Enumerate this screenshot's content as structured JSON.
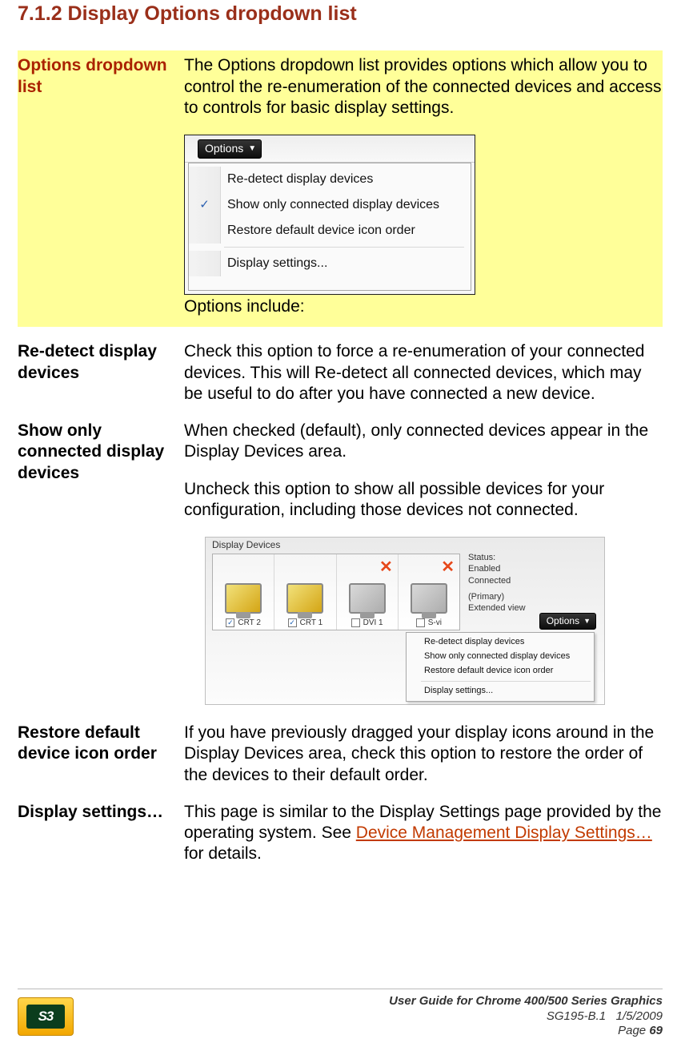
{
  "heading": "7.1.2 Display Options dropdown list",
  "rows": {
    "options_dropdown": {
      "term": "Options dropdown list",
      "intro": "The Options dropdown list provides options which allow you to control the re-enumeration of the connected devices and access to controls for basic display settings.",
      "include_label": "Options include:"
    },
    "redetect": {
      "term": "Re-detect display devices",
      "desc": "Check this option to force a re-enumeration of your connected devices. This will Re-detect all connected devices, which may be useful to do after you have connected a new device."
    },
    "showonly": {
      "term": "Show only connected display devices",
      "p1": "When checked (default), only connected devices appear in the Display Devices area.",
      "p2": "Uncheck this option to show all possible devices for your configuration, including those devices not connected."
    },
    "restore": {
      "term": "Restore default device icon order",
      "desc": "If you have previously dragged your display icons around in the Display Devices area, check this option to restore the order of the devices to their default order."
    },
    "dispset": {
      "term": "Display settings…",
      "desc_pre": "This page is similar to the Display Settings page provided by the operating system. See ",
      "link": "Device Management Display Settings…",
      "desc_post": " for details."
    }
  },
  "shot1": {
    "button": "Options",
    "items": [
      "Re-detect display devices",
      "Show only connected display devices",
      "Restore default device icon order",
      "Display settings..."
    ],
    "checked_index": 1
  },
  "shot2": {
    "panel_title": "Display Devices",
    "button": "Options",
    "devices": [
      {
        "label": "CRT 2",
        "checked": true,
        "connected": true
      },
      {
        "label": "CRT 1",
        "checked": true,
        "connected": true
      },
      {
        "label": "DVI 1",
        "checked": false,
        "connected": false
      },
      {
        "label": "S-vi",
        "checked": false,
        "connected": false
      }
    ],
    "status": {
      "title": "Status:",
      "line1": "Enabled",
      "line2": "Connected",
      "line3": "(Primary)",
      "line4": "Extended view"
    },
    "menu": [
      "Re-detect display devices",
      "Show only connected display devices",
      "Restore default device icon order",
      "Display settings..."
    ]
  },
  "footer": {
    "logo_text": "S3",
    "line1": "User Guide for Chrome 400/500 Series Graphics",
    "line2a": "SG195-B.1",
    "line2b": "1/5/2009",
    "page_label": "Page ",
    "page_num": "69"
  }
}
